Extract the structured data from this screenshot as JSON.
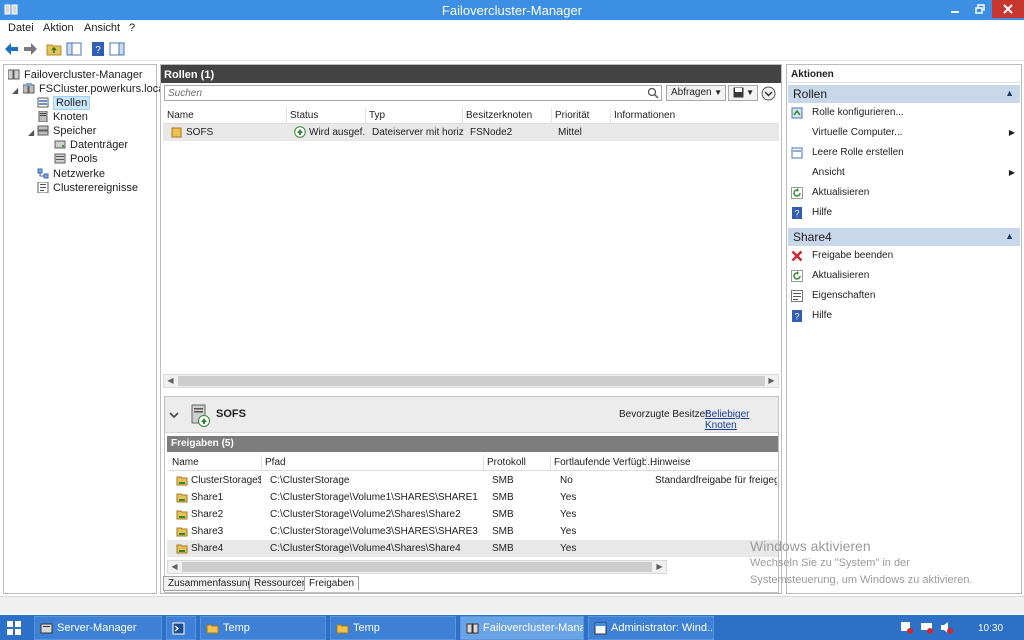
{
  "window": {
    "title": "Failovercluster-Manager"
  },
  "menu": [
    "Datei",
    "Aktion",
    "Ansicht",
    "?"
  ],
  "tree": {
    "root": "Failovercluster-Manager",
    "cluster": "FSCluster.powerkurs.local",
    "roles": "Rollen",
    "nodes": "Knoten",
    "storage": "Speicher",
    "disks": "Datenträger",
    "pools": "Pools",
    "networks": "Netzwerke",
    "events": "Clusterereignisse"
  },
  "roles_pane": {
    "header": "Rollen (1)",
    "search_placeholder": "Suchen",
    "query_btn": "Abfragen",
    "columns": [
      "Name",
      "Status",
      "Typ",
      "Besitzerknoten",
      "Priorität",
      "Informationen"
    ],
    "rows": [
      {
        "name": "SOFS",
        "status": "Wird ausgef...",
        "type": "Dateiserver mit horizo...",
        "owner": "FSNode2",
        "priority": "Mittel",
        "info": ""
      }
    ]
  },
  "detail": {
    "title": "SOFS",
    "preferred_owners_label": "Bevorzugte Besitzer:",
    "preferred_owners_link": "Beliebiger Knoten",
    "shares_header": "Freigaben (5)",
    "columns": [
      "Name",
      "Pfad",
      "Protokoll",
      "Fortlaufende Verfügb...",
      "Hinweise"
    ],
    "rows": [
      {
        "name": "ClusterStorage$",
        "path": "C:\\ClusterStorage",
        "protocol": "SMB",
        "ca": "No",
        "notes": "Standardfreigabe für freigegebe"
      },
      {
        "name": "Share1",
        "path": "C:\\ClusterStorage\\Volume1\\SHARES\\SHARE1",
        "protocol": "SMB",
        "ca": "Yes",
        "notes": ""
      },
      {
        "name": "Share2",
        "path": "C:\\ClusterStorage\\Volume2\\Shares\\Share2",
        "protocol": "SMB",
        "ca": "Yes",
        "notes": ""
      },
      {
        "name": "Share3",
        "path": "C:\\ClusterStorage\\Volume3\\SHARES\\SHARE3",
        "protocol": "SMB",
        "ca": "Yes",
        "notes": ""
      },
      {
        "name": "Share4",
        "path": "C:\\ClusterStorage\\Volume4\\Shares\\Share4",
        "protocol": "SMB",
        "ca": "Yes",
        "notes": ""
      }
    ],
    "tabs": [
      "Zusammenfassung",
      "Ressourcen",
      "Freigaben"
    ]
  },
  "actions": {
    "title": "Aktionen",
    "sections": [
      {
        "title": "Rollen",
        "items": [
          {
            "label": "Rolle konfigurieren...",
            "icon": "configure-role-icon",
            "submenu": false
          },
          {
            "label": "Virtuelle Computer...",
            "icon": "",
            "submenu": true
          },
          {
            "label": "Leere Rolle erstellen",
            "icon": "empty-role-icon",
            "submenu": false
          },
          {
            "label": "Ansicht",
            "icon": "",
            "submenu": true
          },
          {
            "label": "Aktualisieren",
            "icon": "refresh-icon",
            "submenu": false
          },
          {
            "label": "Hilfe",
            "icon": "help-icon",
            "submenu": false
          }
        ]
      },
      {
        "title": "Share4",
        "items": [
          {
            "label": "Freigabe beenden",
            "icon": "stop-share-icon",
            "submenu": false
          },
          {
            "label": "Aktualisieren",
            "icon": "refresh-icon",
            "submenu": false
          },
          {
            "label": "Eigenschaften",
            "icon": "properties-icon",
            "submenu": false
          },
          {
            "label": "Hilfe",
            "icon": "help-icon",
            "submenu": false
          }
        ]
      }
    ]
  },
  "watermark": {
    "line1": "Windows aktivieren",
    "line2": "Wechseln Sie zu \"System\" in der",
    "line3": "Systemsteuerung, um Windows zu aktivieren."
  },
  "taskbar": {
    "items": [
      "Server-Manager",
      "",
      "Temp",
      "Temp",
      "Failovercluster-Mana...",
      "Administrator: Wind..."
    ],
    "clock": "10:30"
  },
  "colors": {
    "titlebar": "#3c8fe3",
    "taskbar": "#2c70c8",
    "close": "#c7372f",
    "section": "#c9d7ea"
  }
}
